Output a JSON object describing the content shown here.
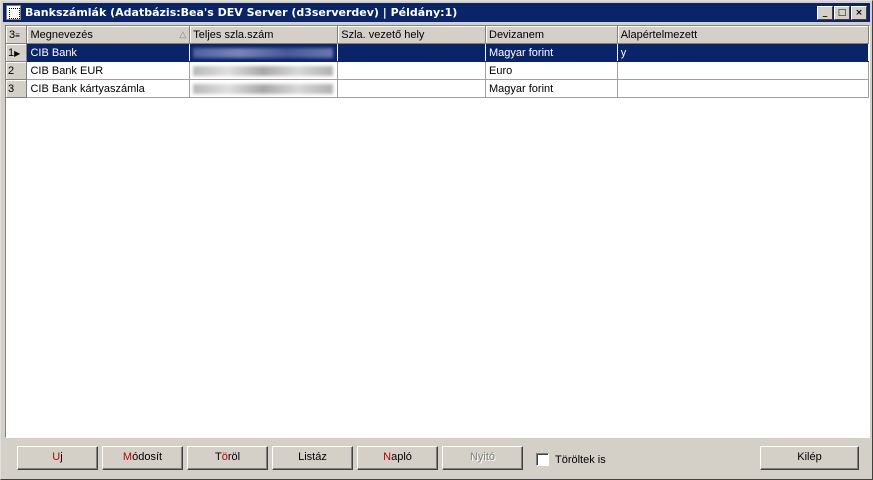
{
  "window": {
    "title": "Bankszámlák  (Adatbázis:Bea's DEV Server (d3serverdev) | Példány:1)",
    "minimize_glyph": "_",
    "maximize_glyph": "□",
    "close_glyph": "×"
  },
  "grid": {
    "record_count": "3",
    "columns": [
      "Megnevezés",
      "Teljes szla.szám",
      "Szla. vezető hely",
      "Devizanem",
      "Alapértelmezett"
    ],
    "sort_indicator": "△",
    "rows": [
      {
        "num": "1",
        "name": "CIB Bank",
        "account": "",
        "branch": "",
        "currency": "Magyar forint",
        "default": "y"
      },
      {
        "num": "2",
        "name": "CIB Bank EUR",
        "account": "",
        "branch": "",
        "currency": "Euro",
        "default": ""
      },
      {
        "num": "3",
        "name": "CIB Bank kártyaszámla",
        "account": "",
        "branch": "",
        "currency": "Magyar forint",
        "default": ""
      }
    ]
  },
  "footer": {
    "new_hot": "U",
    "new_rest": "j",
    "edit_hot": "M",
    "edit_rest": "ódosít",
    "delete_pre": "T",
    "delete_hot": "ö",
    "delete_rest": "röl",
    "list_label": "Listáz",
    "log_hot": "N",
    "log_rest": "apló",
    "open_label": "Nyitó",
    "deleted_too_label": "Töröltek is",
    "exit_label": "Kilép"
  },
  "colors": {
    "selection": "#0a246a",
    "hotkey": "#c00000"
  }
}
